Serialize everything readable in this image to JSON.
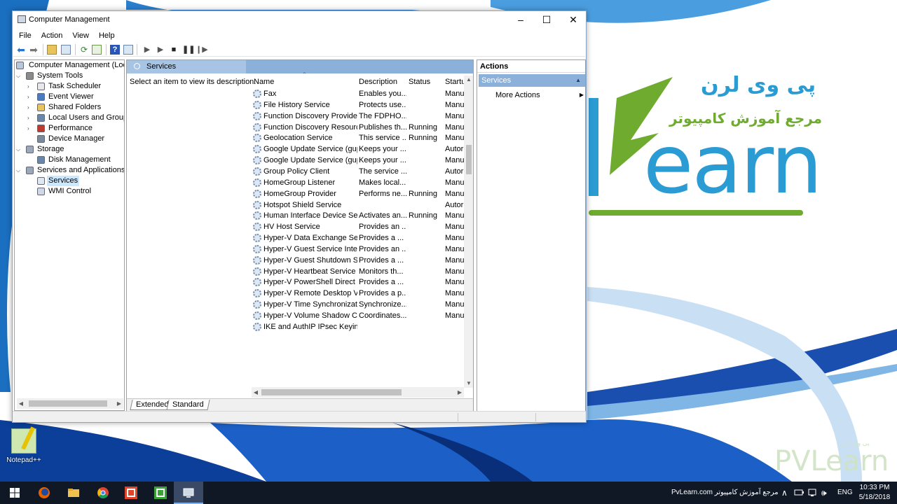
{
  "window": {
    "title": "Computer Management",
    "controls": {
      "minimize": "–",
      "maximize": "☐",
      "close": "✕"
    }
  },
  "menu": [
    "File",
    "Action",
    "View",
    "Help"
  ],
  "toolbar": {
    "buttons": [
      "back-icon",
      "forward-icon",
      "up-folder-icon",
      "show-hide-tree-icon",
      "refresh-icon",
      "export-list-icon",
      "help-icon",
      "show-hide-action-icon",
      "start-service-icon",
      "start-service-alt-icon",
      "stop-service-icon",
      "pause-service-icon",
      "resume-service-icon"
    ]
  },
  "tree": {
    "root": "Computer Management (Local",
    "items": [
      {
        "label": "System Tools",
        "level": 1,
        "icon": "tools-icon",
        "expanded": true
      },
      {
        "label": "Task Scheduler",
        "level": 2,
        "icon": "clock-icon"
      },
      {
        "label": "Event Viewer",
        "level": 2,
        "icon": "event-viewer-icon"
      },
      {
        "label": "Shared Folders",
        "level": 2,
        "icon": "shared-folder-icon"
      },
      {
        "label": "Local Users and Groups",
        "level": 2,
        "icon": "users-icon"
      },
      {
        "label": "Performance",
        "level": 2,
        "icon": "performance-icon"
      },
      {
        "label": "Device Manager",
        "level": 2,
        "icon": "device-manager-icon"
      },
      {
        "label": "Storage",
        "level": 1,
        "icon": "storage-icon",
        "expanded": true
      },
      {
        "label": "Disk Management",
        "level": 2,
        "icon": "disk-icon"
      },
      {
        "label": "Services and Applications",
        "level": 1,
        "icon": "services-apps-icon",
        "expanded": true
      },
      {
        "label": "Services",
        "level": 2,
        "icon": "gear-icon",
        "selected": true
      },
      {
        "label": "WMI Control",
        "level": 2,
        "icon": "wmi-icon"
      }
    ]
  },
  "center": {
    "header": "Services",
    "description_prompt": "Select an item to view its description.",
    "columns": [
      "Name",
      "Description",
      "Status",
      "Startu"
    ],
    "rows": [
      {
        "name": "Fax",
        "description": "Enables you...",
        "status": "",
        "startup": "Manu"
      },
      {
        "name": "File History Service",
        "description": "Protects use...",
        "status": "",
        "startup": "Manu"
      },
      {
        "name": "Function Discovery Provide...",
        "description": "The FDPHO...",
        "status": "",
        "startup": "Manu"
      },
      {
        "name": "Function Discovery Resourc...",
        "description": "Publishes th...",
        "status": "Running",
        "startup": "Manu"
      },
      {
        "name": "Geolocation Service",
        "description": "This service ...",
        "status": "Running",
        "startup": "Manu"
      },
      {
        "name": "Google Update Service (gup...",
        "description": "Keeps your ...",
        "status": "",
        "startup": "Autor"
      },
      {
        "name": "Google Update Service (gup...",
        "description": "Keeps your ...",
        "status": "",
        "startup": "Manu"
      },
      {
        "name": "Group Policy Client",
        "description": "The service ...",
        "status": "",
        "startup": "Autor"
      },
      {
        "name": "HomeGroup Listener",
        "description": "Makes local...",
        "status": "",
        "startup": "Manu"
      },
      {
        "name": "HomeGroup Provider",
        "description": "Performs ne...",
        "status": "Running",
        "startup": "Manu"
      },
      {
        "name": "Hotspot Shield Service",
        "description": "",
        "status": "",
        "startup": "Autor"
      },
      {
        "name": "Human Interface Device Ser...",
        "description": "Activates an...",
        "status": "Running",
        "startup": "Manu"
      },
      {
        "name": "HV Host Service",
        "description": "Provides an ...",
        "status": "",
        "startup": "Manu"
      },
      {
        "name": "Hyper-V Data Exchange Ser...",
        "description": "Provides a ...",
        "status": "",
        "startup": "Manu"
      },
      {
        "name": "Hyper-V Guest Service Inter...",
        "description": "Provides an ...",
        "status": "",
        "startup": "Manu"
      },
      {
        "name": "Hyper-V Guest Shutdown S...",
        "description": "Provides a ...",
        "status": "",
        "startup": "Manu"
      },
      {
        "name": "Hyper-V Heartbeat Service",
        "description": "Monitors th...",
        "status": "",
        "startup": "Manu"
      },
      {
        "name": "Hyper-V PowerShell Direct ...",
        "description": "Provides a ...",
        "status": "",
        "startup": "Manu"
      },
      {
        "name": "Hyper-V Remote Desktop Vi...",
        "description": "Provides a p...",
        "status": "",
        "startup": "Manu"
      },
      {
        "name": "Hyper-V Time Synchronizat...",
        "description": "Synchronize...",
        "status": "",
        "startup": "Manu"
      },
      {
        "name": "Hyper-V Volume Shadow C...",
        "description": "Coordinates...",
        "status": "",
        "startup": "Manu"
      },
      {
        "name": "IKE and AuthIP IPsec Keying...",
        "description": "",
        "status": "",
        "startup": ""
      }
    ],
    "tabs": [
      "Extended",
      "Standard"
    ]
  },
  "actions": {
    "title": "Actions",
    "section": "Services",
    "items": [
      "More Actions"
    ]
  },
  "desktop": {
    "icon_label": "Notepad++",
    "logo_fa_title": "پی وی لرن",
    "logo_fa_subtitle": "مرجع آموزش کامپیوتر",
    "logo_text": "earn",
    "watermark": "PV",
    "watermark_fa": "پی وی لرن"
  },
  "taskbar": {
    "apps": [
      "windows-start-icon",
      "firefox-icon",
      "file-explorer-icon",
      "chrome-icon",
      "camtasia-recorder-icon",
      "camtasia-icon",
      "computer-management-icon"
    ],
    "tray_text": "PvLearn.com مرجع آموزش کامپیوتر",
    "tray_symbols": {
      "chevron": "∧",
      "volume": "🕪"
    },
    "language": "ENG",
    "time": "10:33 PM",
    "date": "5/18/2018"
  },
  "colors": {
    "accent_blue": "#2b9bd3",
    "accent_green": "#6eab2f",
    "selection_header": "#8bb0d9",
    "taskbar": "#101825"
  }
}
